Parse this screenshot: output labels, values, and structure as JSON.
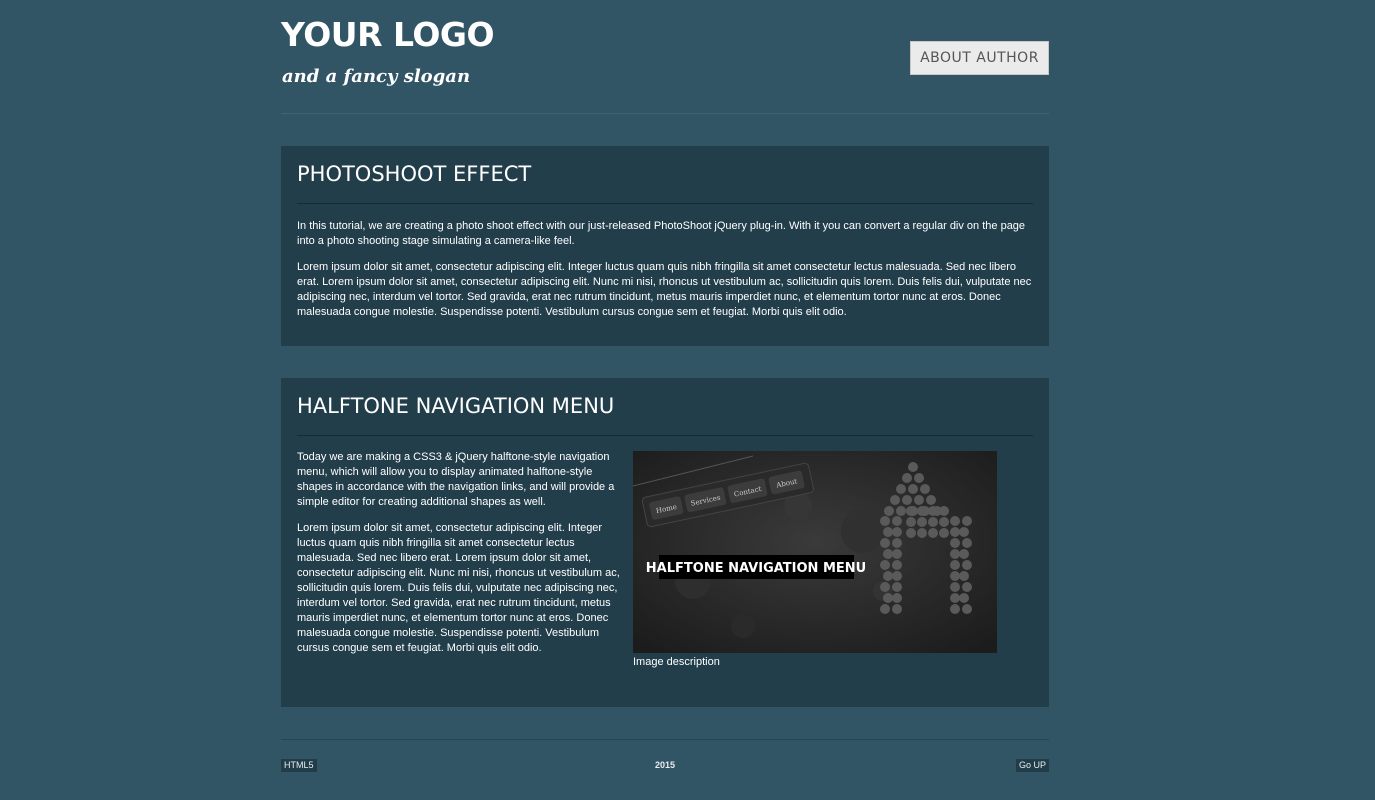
{
  "header": {
    "logo": "YOUR LOGO",
    "slogan": "and a fancy slogan",
    "about_button": "ABOUT AUTHOR"
  },
  "articles": [
    {
      "title": "PHOTOSHOOT EFFECT",
      "paragraphs": [
        "In this tutorial, we are creating a photo shoot effect with our just-released PhotoShoot jQuery plug-in. With it you can convert a regular div on the page into a photo shooting stage simulating a camera-like feel.",
        "Lorem ipsum dolor sit amet, consectetur adipiscing elit. Integer luctus quam quis nibh fringilla sit amet consectetur lectus malesuada. Sed nec libero erat. Lorem ipsum dolor sit amet, consectetur adipiscing elit. Nunc mi nisi, rhoncus ut vestibulum ac, sollicitudin quis lorem. Duis felis dui, vulputate nec adipiscing nec, interdum vel tortor. Sed gravida, erat nec rutrum tincidunt, metus mauris imperdiet nunc, et elementum tortor nunc at eros. Donec malesuada congue molestie. Suspendisse potenti. Vestibulum cursus congue sem et feugiat. Morbi quis elit odio."
      ]
    },
    {
      "title": "HALFTONE NAVIGATION MENU",
      "paragraphs": [
        "Today we are making a CSS3 & jQuery halftone-style navigation menu, which will allow you to display animated halftone-style shapes in accordance with the navigation links, and will provide a simple editor for creating additional shapes as well.",
        "Lorem ipsum dolor sit amet, consectetur adipiscing elit. Integer luctus quam quis nibh fringilla sit amet consectetur lectus malesuada. Sed nec libero erat. Lorem ipsum dolor sit amet, consectetur adipiscing elit. Nunc mi nisi, rhoncus ut vestibulum ac, sollicitudin quis lorem. Duis felis dui, vulputate nec adipiscing nec, interdum vel tortor. Sed gravida, erat nec rutrum tincidunt, metus mauris imperdiet nunc, et elementum tortor nunc at eros. Donec malesuada congue molestie. Suspendisse potenti. Vestibulum cursus congue sem et feugiat. Morbi quis elit odio."
      ],
      "image": {
        "nav_items": [
          "Home",
          "Services",
          "Contact",
          "About"
        ],
        "banner_text": "HALFTONE NAVIGATION MENU",
        "caption": "Image description"
      }
    }
  ],
  "footer": {
    "left_badge": "HTML5",
    "year": "2015",
    "right_badge": "Go UP"
  },
  "colors": {
    "page_background": "#325566",
    "panel_background": "#233e4b",
    "button_background": "#ebebeb",
    "button_text": "#555555"
  }
}
